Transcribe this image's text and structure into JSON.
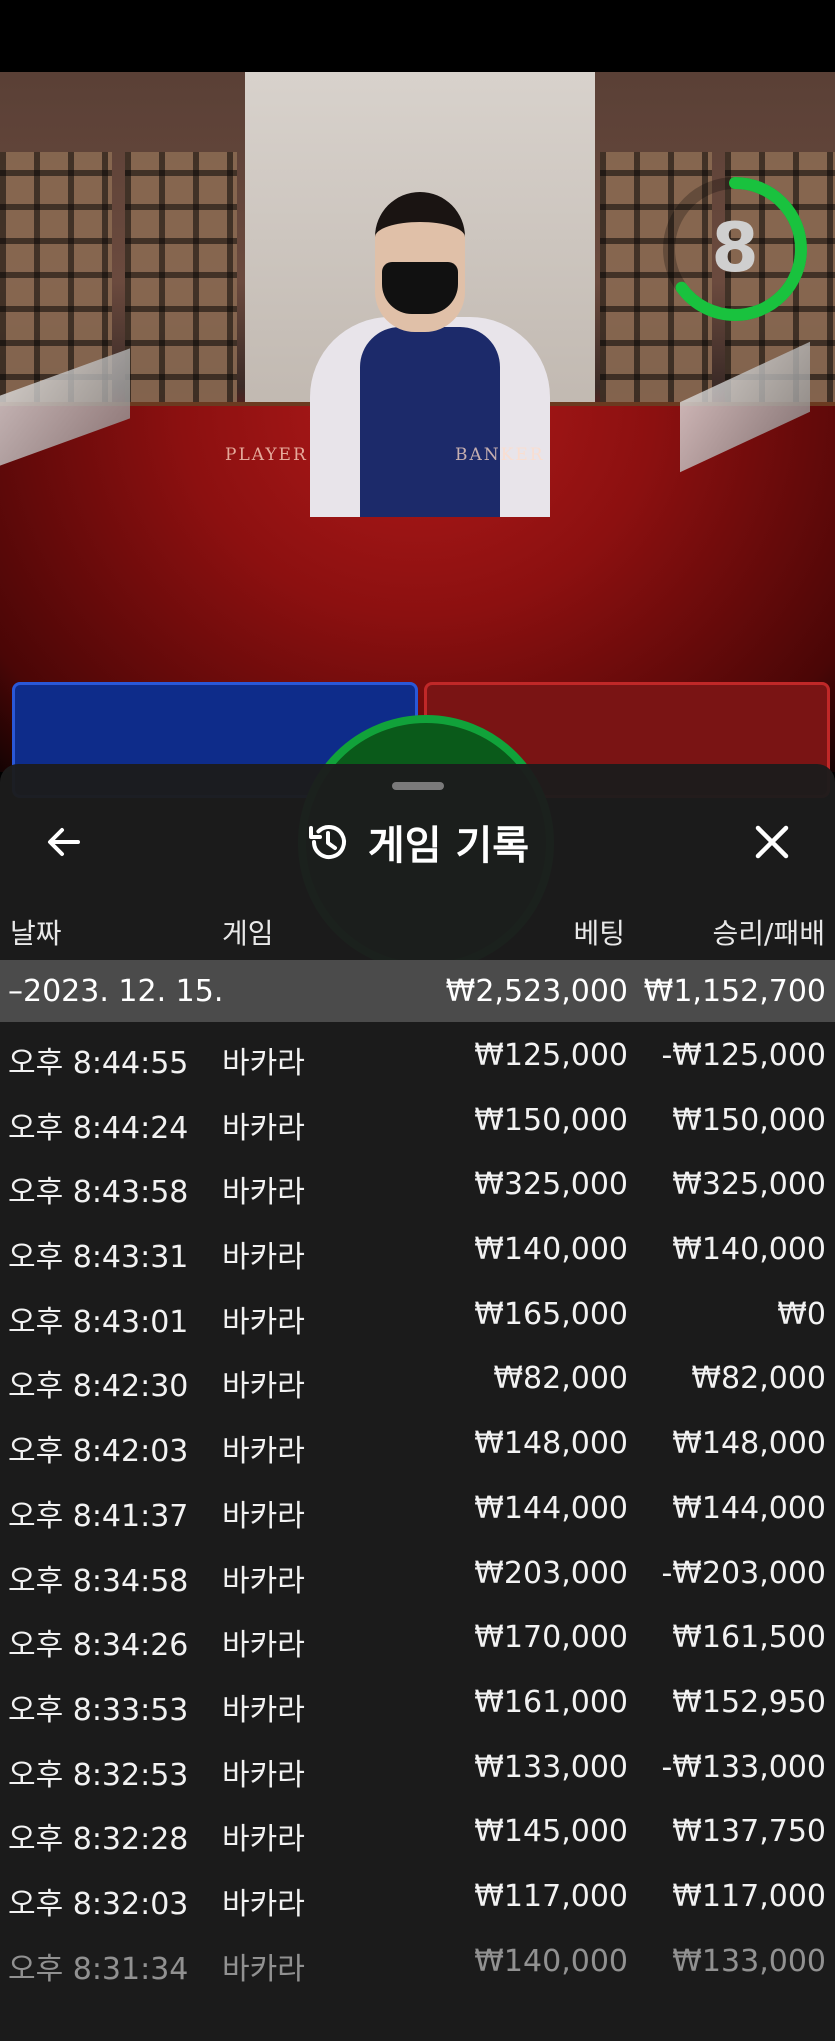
{
  "video": {
    "countdown": "8",
    "countdown_fraction": 0.65,
    "felt_labels": [
      "PLAYER",
      "BANKER"
    ]
  },
  "history": {
    "title": "게임 기록",
    "icons": {
      "back": "arrow-left-icon",
      "history": "history-icon",
      "close": "close-icon"
    },
    "columns": {
      "date": "날짜",
      "game": "게임",
      "bet": "베팅",
      "result": "승리/패배"
    },
    "summary": {
      "date": "–2023. 12. 15.",
      "bet": "₩2,523,000",
      "result": "₩1,152,700"
    },
    "rows": [
      {
        "time": "오후 8:44:55",
        "game": "바카라",
        "bet": "₩125,000",
        "result": "-₩125,000"
      },
      {
        "time": "오후 8:44:24",
        "game": "바카라",
        "bet": "₩150,000",
        "result": "₩150,000"
      },
      {
        "time": "오후 8:43:58",
        "game": "바카라",
        "bet": "₩325,000",
        "result": "₩325,000"
      },
      {
        "time": "오후 8:43:31",
        "game": "바카라",
        "bet": "₩140,000",
        "result": "₩140,000"
      },
      {
        "time": "오후 8:43:01",
        "game": "바카라",
        "bet": "₩165,000",
        "result": "₩0"
      },
      {
        "time": "오후 8:42:30",
        "game": "바카라",
        "bet": "₩82,000",
        "result": "₩82,000"
      },
      {
        "time": "오후 8:42:03",
        "game": "바카라",
        "bet": "₩148,000",
        "result": "₩148,000"
      },
      {
        "time": "오후 8:41:37",
        "game": "바카라",
        "bet": "₩144,000",
        "result": "₩144,000"
      },
      {
        "time": "오후 8:34:58",
        "game": "바카라",
        "bet": "₩203,000",
        "result": "-₩203,000"
      },
      {
        "time": "오후 8:34:26",
        "game": "바카라",
        "bet": "₩170,000",
        "result": "₩161,500"
      },
      {
        "time": "오후 8:33:53",
        "game": "바카라",
        "bet": "₩161,000",
        "result": "₩152,950"
      },
      {
        "time": "오후 8:32:53",
        "game": "바카라",
        "bet": "₩133,000",
        "result": "-₩133,000"
      },
      {
        "time": "오후 8:32:28",
        "game": "바카라",
        "bet": "₩145,000",
        "result": "₩137,750"
      },
      {
        "time": "오후 8:32:03",
        "game": "바카라",
        "bet": "₩117,000",
        "result": "₩117,000"
      },
      {
        "time": "오후 8:31:34",
        "game": "바카라",
        "bet": "₩140,000",
        "result": "₩133,000"
      }
    ]
  }
}
